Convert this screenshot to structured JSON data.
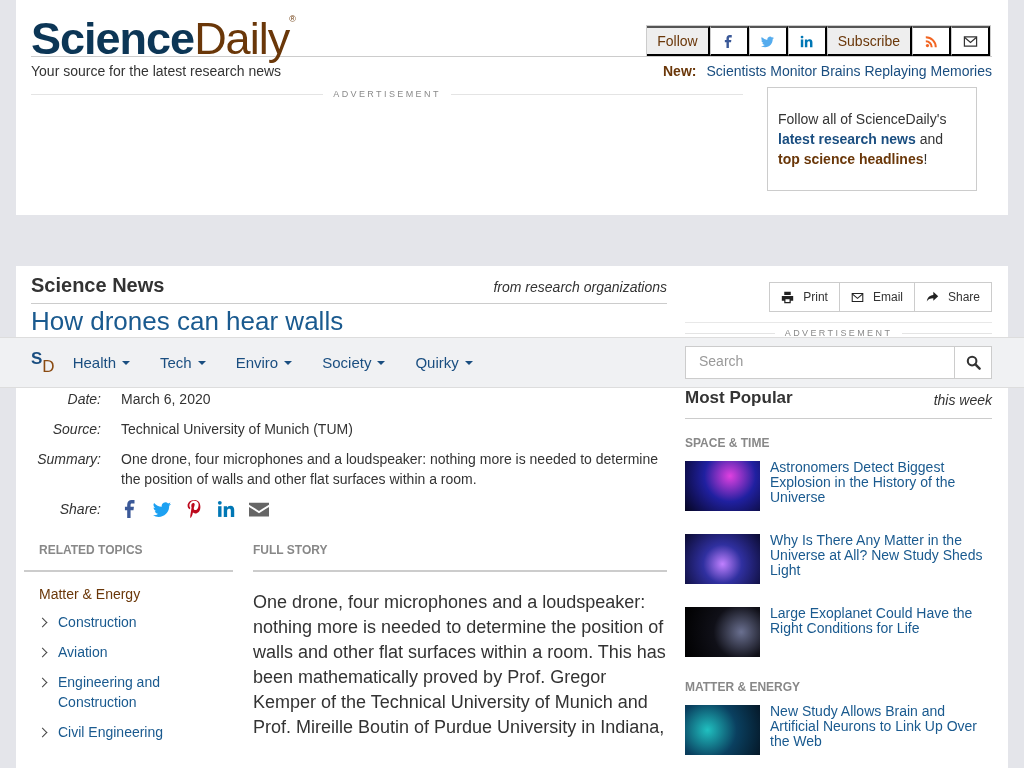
{
  "header": {
    "logo": {
      "science": "Science",
      "daily": "Daily",
      "mark": "®"
    },
    "tagline": "Your source for the latest research news",
    "social": [
      {
        "kind": "text",
        "label": "Follow"
      },
      {
        "kind": "facebook"
      },
      {
        "kind": "twitter"
      },
      {
        "kind": "linkedin"
      },
      {
        "kind": "text",
        "label": "Subscribe"
      },
      {
        "kind": "rss"
      },
      {
        "kind": "mail"
      }
    ],
    "new_label": "New:",
    "new_link": "Scientists Monitor Brains Replaying Memories",
    "ad_label": "ADVERTISEMENT",
    "promo": "Follow all of ScienceDaily's **latest research news** and **top science headlines**!"
  },
  "article": {
    "section_title": "Science News",
    "section_note": "from research organizations",
    "headline": "How drones can hear walls",
    "meta": [
      {
        "label": "Date:",
        "value": "March 6, 2020"
      },
      {
        "label": "Source:",
        "value": "Technical University of Munich (TUM)"
      },
      {
        "label": "Summary:",
        "value": "One drone, four microphones and a loudspeaker: nothing more is needed to determine the position of walls and other flat surfaces within a room."
      }
    ],
    "share_label": "Share:",
    "share": [
      {
        "kind": "facebook"
      },
      {
        "kind": "twitter"
      },
      {
        "kind": "pinterest"
      },
      {
        "kind": "linkedin"
      },
      {
        "kind": "mail"
      }
    ],
    "related_title": "RELATED TOPICS",
    "topic_group": "Matter & Energy",
    "topics": [
      {
        "label": "Construction"
      },
      {
        "label": "Aviation"
      },
      {
        "label": "Engineering and Construction"
      },
      {
        "label": "Civil Engineering"
      }
    ],
    "full_story_title": "FULL STORY",
    "body": "One drone, four microphones and a loudspeaker: nothing more is needed to determine the position of walls and other flat surfaces within a room. This has been mathematically proved by Prof. Gregor Kemper of the Technical University of Munich and Prof. Mireille Boutin of Purdue University in Indiana,"
  },
  "sidebar": {
    "tools": [
      {
        "kind": "print",
        "label": "Print"
      },
      {
        "kind": "mail",
        "label": "Email"
      },
      {
        "kind": "share",
        "label": "Share"
      }
    ],
    "ad_label": "ADVERTISEMENT",
    "popular_title": "Most Popular",
    "popular_note": "this week",
    "sections": [
      {
        "title": "SPACE & TIME",
        "items": [
          {
            "title": "Astronomers Detect Biggest Explosion in the History of the Universe"
          },
          {
            "title": "Why Is There Any Matter in the Universe at All? New Study Sheds Light"
          },
          {
            "title": "Large Exoplanet Could Have the Right Conditions for Life"
          }
        ]
      },
      {
        "title": "MATTER & ENERGY",
        "items": [
          {
            "title": "New Study Allows Brain and Artificial Neurons to Link Up Over the Web"
          }
        ]
      }
    ]
  },
  "navbar": {
    "logo": {
      "s": "S",
      "d": "D"
    },
    "menus": [
      {
        "label": "Health"
      },
      {
        "label": "Tech"
      },
      {
        "label": "Enviro"
      },
      {
        "label": "Society"
      },
      {
        "label": "Quirky"
      }
    ],
    "search": {
      "placeholder": "Search"
    }
  }
}
